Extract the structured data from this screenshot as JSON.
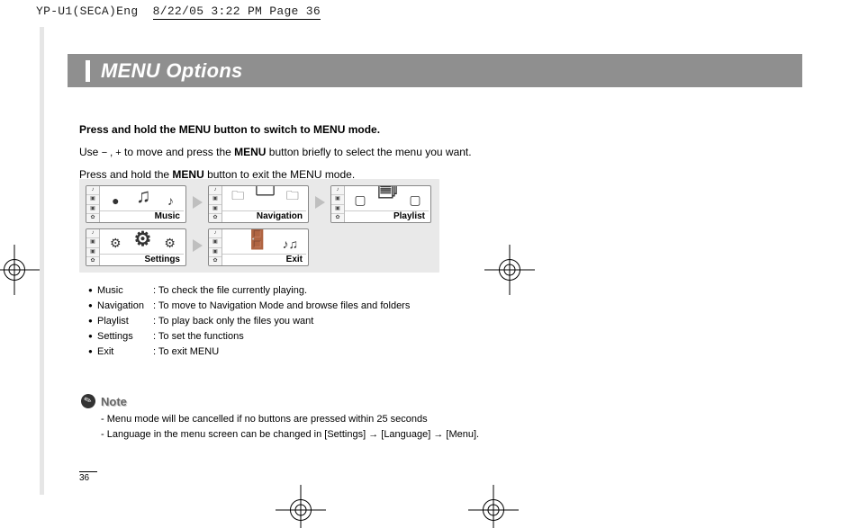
{
  "slug": {
    "file": "YP-U1(SECA)Eng",
    "timestamp": "8/22/05 3:22 PM  Page 36"
  },
  "title": "MENU Options",
  "intro": {
    "line1_pre": "Press and hold the ",
    "line1_bold": "MENU",
    "line1_post": " button to switch to MENU mode.",
    "line2_pre": "Use  ",
    "line2_symbols": "− , +",
    "line2_mid": "  to move and press the ",
    "line2_bold": "MENU",
    "line2_post": " button briefly to select the menu you want.",
    "line3_pre": "Press and hold the ",
    "line3_bold": "MENU",
    "line3_post": " button to exit the MENU mode."
  },
  "screens": {
    "music": "Music",
    "navigation": "Navigation",
    "playlist": "Playlist",
    "settings": "Settings",
    "exit": "Exit"
  },
  "bullets": [
    {
      "term": "Music",
      "desc": ": To check the file currently playing."
    },
    {
      "term": "Navigation",
      "desc": ": To move to Navigation Mode and browse files and folders"
    },
    {
      "term": "Playlist",
      "desc": ": To play back only the files you want"
    },
    {
      "term": "Settings",
      "desc": ": To set the functions"
    },
    {
      "term": "Exit",
      "desc": ": To exit MENU"
    }
  ],
  "note": {
    "label": "Note",
    "line1": "- Menu mode will be cancelled if no buttons are pressed within 25 seconds",
    "line2": "- Language in the menu screen can be changed in [Settings] →  [Language] → [Menu]."
  },
  "page_number": "36"
}
